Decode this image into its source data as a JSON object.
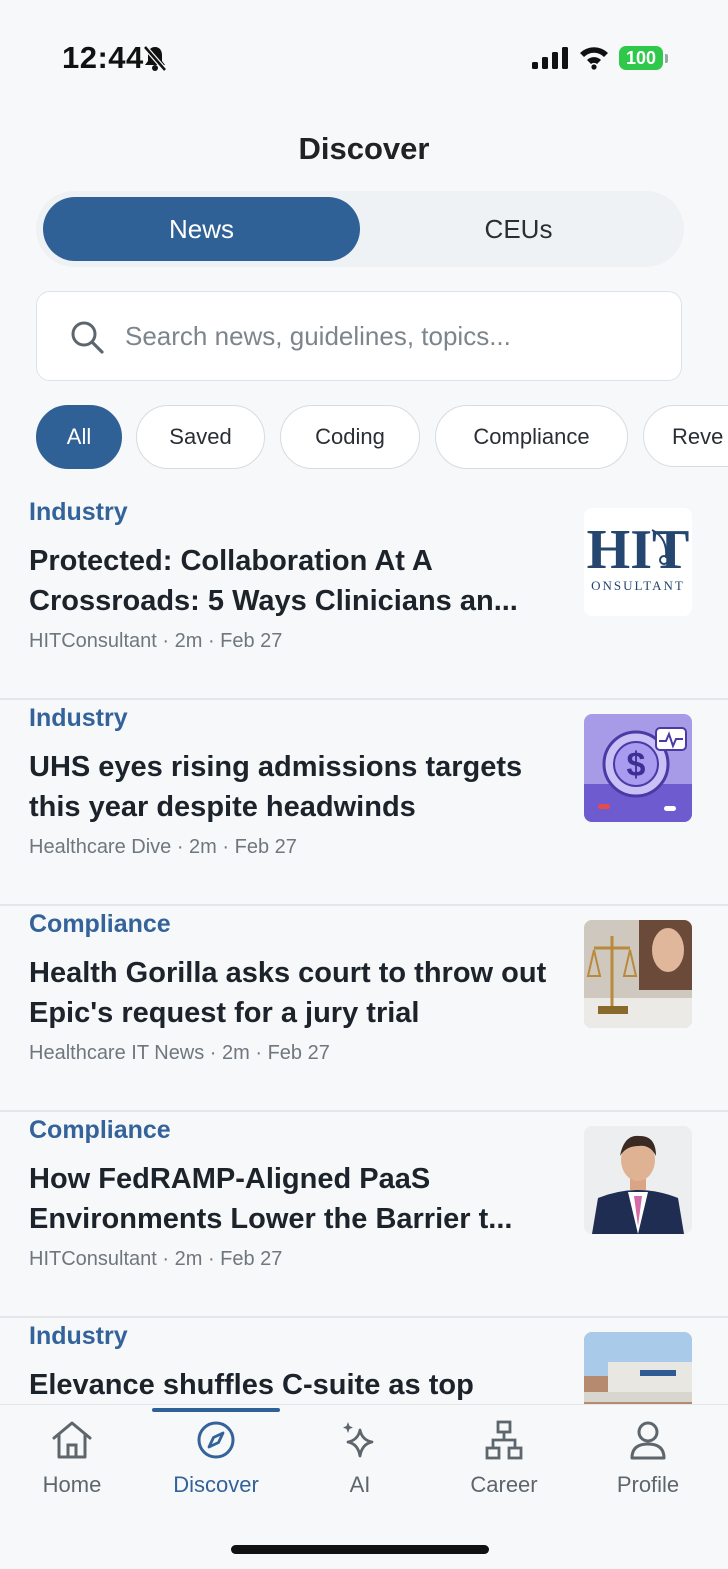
{
  "status": {
    "time": "12:44",
    "battery": "100"
  },
  "header": {
    "title": "Discover"
  },
  "segments": [
    {
      "label": "News"
    },
    {
      "label": "CEUs"
    }
  ],
  "search": {
    "placeholder": "Search news, guidelines, topics..."
  },
  "chips": [
    {
      "label": "All"
    },
    {
      "label": "Saved"
    },
    {
      "label": "Coding"
    },
    {
      "label": "Compliance"
    },
    {
      "label": "Reve"
    }
  ],
  "articles": [
    {
      "category": "Industry",
      "title": "Protected: Collaboration At A Crossroads: 5 Ways Clinicians an...",
      "meta": "HITConsultant · 2m · Feb 27",
      "thumb_text_main": "HIT",
      "thumb_text_sub": "ONSULTANT"
    },
    {
      "category": "Industry",
      "title": "UHS eyes rising admissions targets this year despite headwinds",
      "meta": "Healthcare Dive · 2m · Feb 27"
    },
    {
      "category": "Compliance",
      "title": "Health Gorilla asks court to throw out Epic's request for a jury trial",
      "meta": "Healthcare IT News · 2m · Feb 27"
    },
    {
      "category": "Compliance",
      "title": "How FedRAMP-Aligned PaaS Environments Lower the Barrier t...",
      "meta": "HITConsultant · 2m · Feb 27"
    },
    {
      "category": "Industry",
      "title": "Elevance shuffles C-suite as top",
      "meta": ""
    }
  ],
  "tabs": [
    {
      "label": "Home",
      "icon": "home-icon"
    },
    {
      "label": "Discover",
      "icon": "compass-icon"
    },
    {
      "label": "AI",
      "icon": "sparkles-icon"
    },
    {
      "label": "Career",
      "icon": "org-chart-icon"
    },
    {
      "label": "Profile",
      "icon": "person-icon"
    }
  ],
  "colors": {
    "accent": "#2f6197",
    "category": "#33639a",
    "background": "#f7f8f9",
    "battery": "#2fc84b"
  }
}
